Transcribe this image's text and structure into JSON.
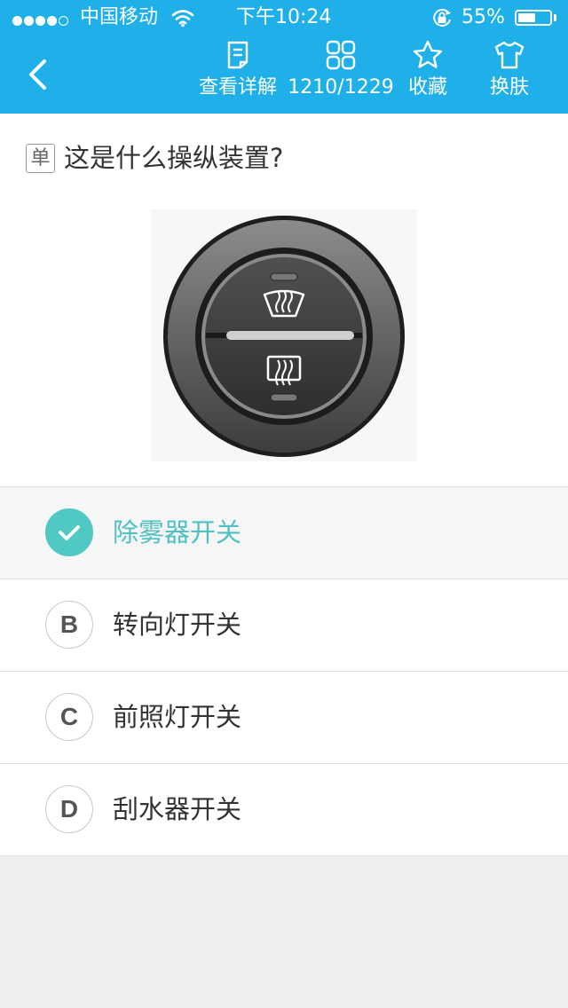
{
  "status_bar": {
    "carrier": "中国移动",
    "time": "下午10:24",
    "battery": "55%",
    "battery_level": 0.55,
    "signal_bars_filled": 4,
    "signal_bars_total": 5,
    "icons": [
      "signal-dots-icon",
      "wifi-icon",
      "orientation-lock-icon",
      "battery-icon"
    ]
  },
  "nav": {
    "back_icon": "chevron-left-icon",
    "details": {
      "label": "查看详解",
      "icon": "document-icon"
    },
    "progress": {
      "label": "1210/1229",
      "icon": "grid-icon"
    },
    "favorite": {
      "label": "收藏",
      "icon": "star-icon"
    },
    "skin": {
      "label": "换肤",
      "icon": "tshirt-icon"
    }
  },
  "question": {
    "type_tag": "单",
    "text": "这是什么操纵装置?",
    "image_icon": "defroster-switch-icon"
  },
  "options": [
    {
      "marker": "check-icon",
      "text": "除雾器开关",
      "selected": true
    },
    {
      "marker": "B",
      "text": "转向灯开关",
      "selected": false
    },
    {
      "marker": "C",
      "text": "前照灯开关",
      "selected": false
    },
    {
      "marker": "D",
      "text": "刮水器开关",
      "selected": false
    }
  ],
  "colors": {
    "header_bg": "#1fb0ea",
    "selected_accent": "#4fc9c2",
    "selected_text": "#4fc1c3",
    "page_bg": "#efefef"
  }
}
